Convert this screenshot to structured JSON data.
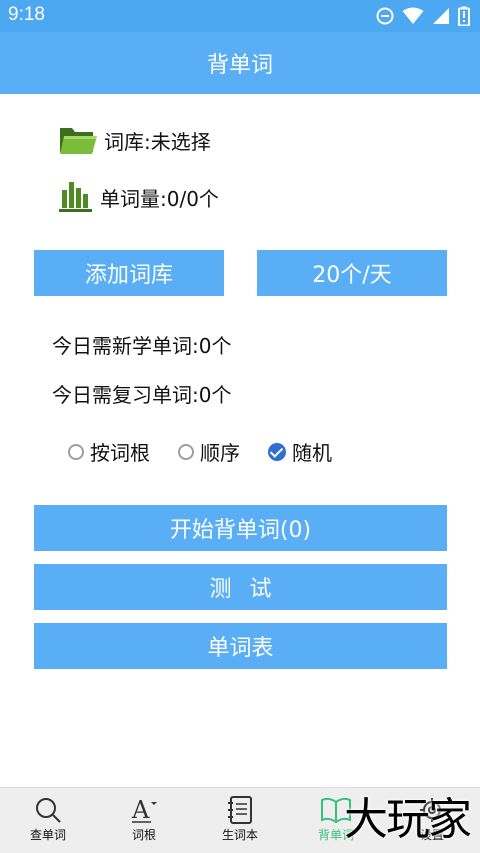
{
  "status_bar": {
    "time": "9:18",
    "icons": [
      "dnd-icon",
      "wifi-icon",
      "signal-icon",
      "battery-icon"
    ]
  },
  "app_bar": {
    "title": "背单词"
  },
  "info": {
    "library": "词库:未选择",
    "word_count": "单词量:0/0个"
  },
  "buttons": {
    "add_library": "添加词库",
    "daily_rate": "20个/天",
    "start": "开始背单词(0)",
    "test": "测试",
    "word_list": "单词表"
  },
  "stats": {
    "new_today": "今日需新学单词:0个",
    "review_today": "今日需复习单词:0个"
  },
  "order_options": [
    {
      "label": "按词根",
      "checked": false
    },
    {
      "label": "顺序",
      "checked": false
    },
    {
      "label": "随机",
      "checked": true
    }
  ],
  "bottom_nav": [
    {
      "label": "查单词",
      "icon": "search-icon",
      "active": false
    },
    {
      "label": "词根",
      "icon": "font-root-icon",
      "active": false
    },
    {
      "label": "生词本",
      "icon": "notebook-icon",
      "active": false
    },
    {
      "label": "背单词",
      "icon": "book-icon",
      "active": true
    },
    {
      "label": "设置",
      "icon": "settings-icon",
      "active": false
    }
  ],
  "watermark": "大玩家",
  "colors": {
    "primary": "#5aaef6",
    "status_bar": "#4da8f2",
    "active_tab": "#36c07a",
    "radio_checked": "#2f6fd0"
  }
}
